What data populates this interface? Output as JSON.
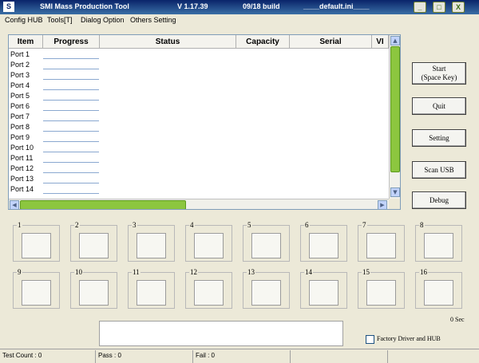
{
  "window": {
    "title": "SMI Mass Production Tool",
    "version": "V 1.17.39",
    "build": "09/18 build",
    "ini": "____default.ini____",
    "minimize": "_",
    "maximize": "□",
    "close": "X"
  },
  "menu": [
    "Config HUB",
    "Tools[T]",
    "Dialog Option",
    "Others Setting"
  ],
  "table": {
    "columns": [
      "Item",
      "Progress",
      "Status",
      "Capacity",
      "Serial",
      "VI"
    ],
    "rows": [
      "Port 1",
      "Port 2",
      "Port 3",
      "Port 4",
      "Port 5",
      "Port 6",
      "Port 7",
      "Port 8",
      "Port 9",
      "Port 10",
      "Port 11",
      "Port 12",
      "Port 13",
      "Port 14"
    ]
  },
  "buttons": {
    "start_line1": "Start",
    "start_line2": "(Space Key)",
    "quit": "Quit",
    "setting": "Setting",
    "scan_usb": "Scan USB",
    "debug": "Debug"
  },
  "ports": [
    "1",
    "2",
    "3",
    "4",
    "5",
    "6",
    "7",
    "8",
    "9",
    "10",
    "11",
    "12",
    "13",
    "14",
    "15",
    "16"
  ],
  "elapsed": "0 Sec",
  "factory_driver_label": "Factory Driver and HUB",
  "status": {
    "test_count": "Test Count : 0",
    "pass": "Pass : 0",
    "fail": "Fail : 0"
  },
  "colors": {
    "title_bar": "#0a246a",
    "scroll_thumb": "#8cc63f",
    "window_bg": "#ece9d8"
  }
}
